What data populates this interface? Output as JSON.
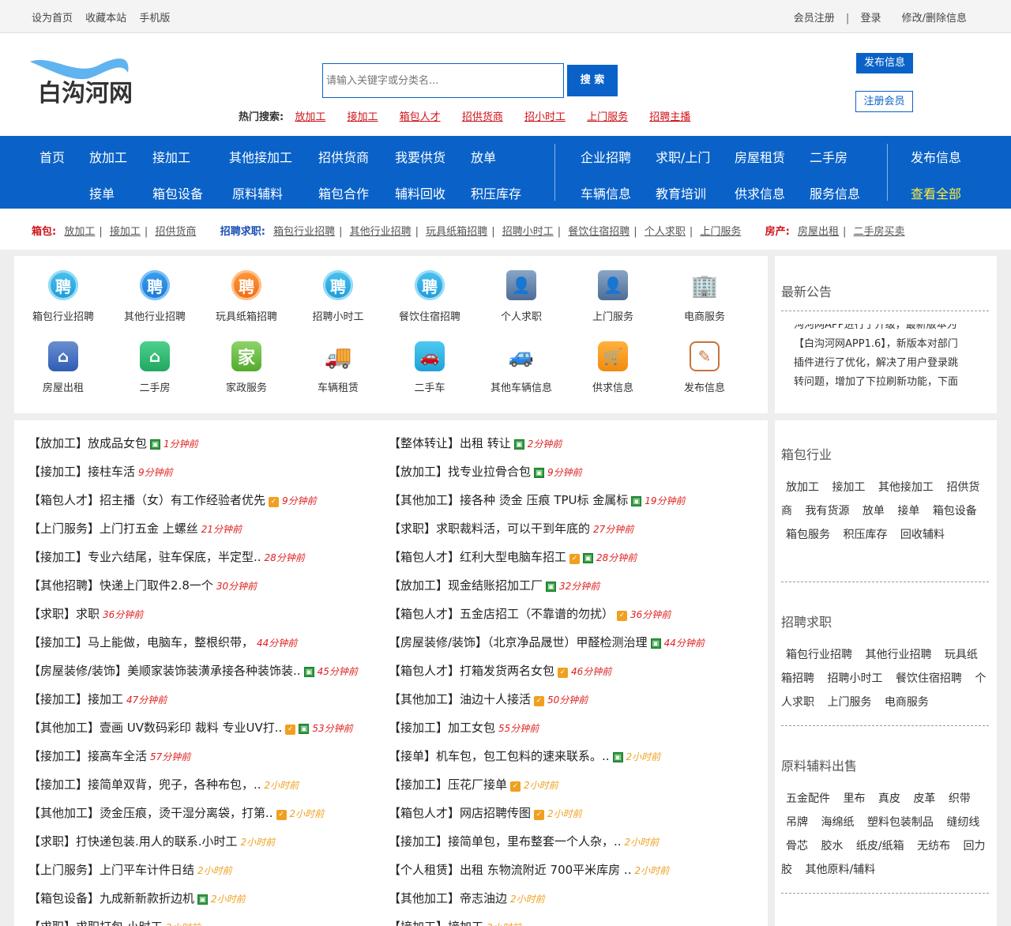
{
  "topbar": {
    "left": [
      "设为首页",
      "收藏本站",
      "手机版"
    ],
    "register": "会员注册",
    "sep": "|",
    "login": "登录",
    "edit": "修改/删除信息"
  },
  "header": {
    "logo_text": "白沟河网",
    "search_placeholder": "请输入关键字或分类名...",
    "search_button": "搜 索",
    "hot_label": "热门搜索:",
    "hot_links": [
      "放加工",
      "接加工",
      "箱包人才",
      "招供货商",
      "招小时工",
      "上门服务",
      "招聘主播"
    ],
    "publish_button": "发布信息",
    "register_button": "注册会员"
  },
  "nav": {
    "row1": [
      "首页",
      "放加工",
      "接加工",
      "其他接加工",
      "招供货商",
      "我要供货",
      "放单",
      "企业招聘",
      "求职/上门",
      "房屋租赁",
      "二手房",
      "发布信息"
    ],
    "row2": [
      "接单",
      "箱包设备",
      "原料辅料",
      "箱包合作",
      "辅料回收",
      "积压库存",
      "车辆信息",
      "教育培训",
      "供求信息",
      "服务信息",
      "查看全部"
    ]
  },
  "subnav": {
    "bag_label": "箱包:",
    "bag_links": [
      "放加工",
      "接加工",
      "招供货商"
    ],
    "job_label": "招聘求职:",
    "job_links": [
      "箱包行业招聘",
      "其他行业招聘",
      "玩具纸箱招聘",
      "招聘小时工",
      "餐饮住宿招聘",
      "个人求职",
      "上门服务"
    ],
    "house_label": "房产:",
    "house_links": [
      "房屋出租",
      "二手房买卖"
    ],
    "bar": "|"
  },
  "categories": [
    {
      "label": "箱包行业招聘",
      "icon": "pin-icon",
      "glyph": "聘"
    },
    {
      "label": "其他行业招聘",
      "icon": "pin-icon",
      "glyph": "聘"
    },
    {
      "label": "玩具纸箱招聘",
      "icon": "pin-icon",
      "glyph": "聘"
    },
    {
      "label": "招聘小时工",
      "icon": "pin-icon",
      "glyph": "聘"
    },
    {
      "label": "餐饮住宿招聘",
      "icon": "pin-icon",
      "glyph": "聘"
    },
    {
      "label": "个人求职",
      "icon": "person-icon",
      "glyph": "👤"
    },
    {
      "label": "上门服务",
      "icon": "person-icon",
      "glyph": "👤"
    },
    {
      "label": "电商服务",
      "icon": "building-icon",
      "glyph": "🏢"
    },
    {
      "label": "房屋出租",
      "icon": "house-icon",
      "glyph": "⌂"
    },
    {
      "label": "二手房",
      "icon": "home-icon",
      "glyph": "⌂"
    },
    {
      "label": "家政服务",
      "icon": "jia-icon",
      "glyph": "家"
    },
    {
      "label": "车辆租赁",
      "icon": "truck-icon",
      "glyph": "🚚"
    },
    {
      "label": "二手车",
      "icon": "car-icon",
      "glyph": "🚗"
    },
    {
      "label": "其他车辆信息",
      "icon": "car-service-icon",
      "glyph": "🚙"
    },
    {
      "label": "供求信息",
      "icon": "cart-icon",
      "glyph": "🛒"
    },
    {
      "label": "发布信息",
      "icon": "publish-icon",
      "glyph": "✎"
    }
  ],
  "notice": {
    "title": "最新公告",
    "lines": [
      "沟河网APP进行了升级，最新版本为",
      "【白沟河网APP1.6】，新版本对部门",
      "插件进行了优化，解决了用户登录跳",
      "转问题，增加了下拉刷新功能，下面"
    ]
  },
  "posts_left": [
    {
      "text": "【放加工】放成品女包",
      "tags": [
        "pic"
      ],
      "time": "1分钟前",
      "hr": false
    },
    {
      "text": "【接加工】接柱车活",
      "tags": [],
      "time": "9分钟前",
      "hr": false
    },
    {
      "text": "【箱包人才】招主播（女）有工作经验者优先",
      "tags": [
        "ver"
      ],
      "time": "9分钟前",
      "hr": false
    },
    {
      "text": "【上门服务】上门打五金 上螺丝",
      "tags": [],
      "time": "21分钟前",
      "hr": false
    },
    {
      "text": "【接加工】专业六结尾，驻车保底，半定型..",
      "tags": [],
      "time": "28分钟前",
      "hr": false
    },
    {
      "text": "【其他招聘】快递上门取件2.8一个",
      "tags": [],
      "time": "30分钟前",
      "hr": false
    },
    {
      "text": "【求职】求职",
      "tags": [],
      "time": "36分钟前",
      "hr": false
    },
    {
      "text": "【接加工】马上能做，电脑车，整根织带，",
      "tags": [],
      "time": "44分钟前",
      "hr": false
    },
    {
      "text": "【房屋装修/装饰】美顺家装饰装潢承接各种装饰装..",
      "tags": [
        "pic"
      ],
      "time": "45分钟前",
      "hr": false
    },
    {
      "text": "【接加工】接加工",
      "tags": [],
      "time": "47分钟前",
      "hr": false
    },
    {
      "text": "【其他加工】壹画 UV数码彩印 裁料 专业UV打..",
      "tags": [
        "ver",
        "pic"
      ],
      "time": "53分钟前",
      "hr": false
    },
    {
      "text": "【接加工】接高车全活",
      "tags": [],
      "time": "57分钟前",
      "hr": false
    },
    {
      "text": "【接加工】接简单双背，兜子，各种布包，..",
      "tags": [],
      "time": "2小时前",
      "hr": true
    },
    {
      "text": "【其他加工】烫金压痕，烫干湿分离袋，打第..",
      "tags": [
        "ver"
      ],
      "time": "2小时前",
      "hr": true
    },
    {
      "text": "【求职】打快递包装.用人的联系.小时工",
      "tags": [],
      "time": "2小时前",
      "hr": true
    },
    {
      "text": "【上门服务】上门平车计件日结",
      "tags": [],
      "time": "2小时前",
      "hr": true
    },
    {
      "text": "【箱包设备】九成新新款折边机",
      "tags": [
        "pic"
      ],
      "time": "2小时前",
      "hr": true
    },
    {
      "text": "【求职】求职打包 小时工",
      "tags": [],
      "time": "2小时前",
      "hr": true
    }
  ],
  "posts_right": [
    {
      "text": "【整体转让】出租 转让",
      "tags": [
        "pic"
      ],
      "time": "2分钟前",
      "hr": false
    },
    {
      "text": "【放加工】找专业拉骨合包",
      "tags": [
        "pic"
      ],
      "time": "9分钟前",
      "hr": false
    },
    {
      "text": "【其他加工】接各种 烫金 压痕 TPU标 金属标",
      "tags": [
        "pic"
      ],
      "time": "19分钟前",
      "hr": false
    },
    {
      "text": "【求职】求职裁料活，可以干到年底的",
      "tags": [],
      "time": "27分钟前",
      "hr": false
    },
    {
      "text": "【箱包人才】红利大型电脑车招工",
      "tags": [
        "ver",
        "pic"
      ],
      "time": "28分钟前",
      "hr": false
    },
    {
      "text": "【放加工】现金结账招加工厂",
      "tags": [
        "pic"
      ],
      "time": "32分钟前",
      "hr": false
    },
    {
      "text": "【箱包人才】五金店招工（不靠谱的勿扰）",
      "tags": [
        "ver"
      ],
      "time": "36分钟前",
      "hr": false
    },
    {
      "text": "【房屋装修/装饰】（北京净品晟世）甲醛检测治理",
      "tags": [
        "pic"
      ],
      "time": "44分钟前",
      "hr": false
    },
    {
      "text": "【箱包人才】打箱发货两名女包",
      "tags": [
        "ver"
      ],
      "time": "46分钟前",
      "hr": false
    },
    {
      "text": "【其他加工】油边十人接活",
      "tags": [
        "ver"
      ],
      "time": "50分钟前",
      "hr": false
    },
    {
      "text": "【接加工】加工女包",
      "tags": [],
      "time": "55分钟前",
      "hr": false
    },
    {
      "text": "【接单】机车包，包工包料的速来联系。..",
      "tags": [
        "pic"
      ],
      "time": "2小时前",
      "hr": true
    },
    {
      "text": "【接加工】压花厂接单",
      "tags": [
        "ver"
      ],
      "time": "2小时前",
      "hr": true
    },
    {
      "text": "【箱包人才】网店招聘传图",
      "tags": [
        "ver"
      ],
      "time": "2小时前",
      "hr": true
    },
    {
      "text": "【接加工】接简单包，里布整套一个人杂，..",
      "tags": [],
      "time": "2小时前",
      "hr": true
    },
    {
      "text": "【个人租赁】出租 东物流附近 700平米库房 ..",
      "tags": [],
      "time": "2小时前",
      "hr": true
    },
    {
      "text": "【其他加工】帝志油边",
      "tags": [],
      "time": "2小时前",
      "hr": true
    },
    {
      "text": "【接加工】接加工",
      "tags": [],
      "time": "2小时前",
      "hr": true
    }
  ],
  "sidebar": {
    "bag_title": "箱包行业",
    "bag_links": [
      "放加工",
      "接加工",
      "其他接加工",
      "招供货商",
      "我有货源",
      "放单",
      "接单",
      "箱包设备",
      "箱包服务",
      "积压库存",
      "回收辅料"
    ],
    "job_title": "招聘求职",
    "job_links": [
      "箱包行业招聘",
      "其他行业招聘",
      "玩具纸箱招聘",
      "招聘小时工",
      "餐饮住宿招聘",
      "个人求职",
      "上门服务",
      "电商服务"
    ],
    "mat_title": "原料辅料出售",
    "mat_links": [
      "五金配件",
      "里布",
      "真皮",
      "皮革",
      "织带",
      "吊牌",
      "海绵纸",
      "塑料包装制品",
      "缝纫线",
      "骨芯",
      "胶水",
      "纸皮/纸箱",
      "无纺布",
      "回力胶",
      "其他原料/辅料"
    ]
  },
  "colors": {
    "brand_blue": "#0a62c8",
    "hot_red": "#d0151c",
    "time_red": "#e02020",
    "time_orange": "#f0a020",
    "nav_highlight": "#ffeb3b"
  }
}
